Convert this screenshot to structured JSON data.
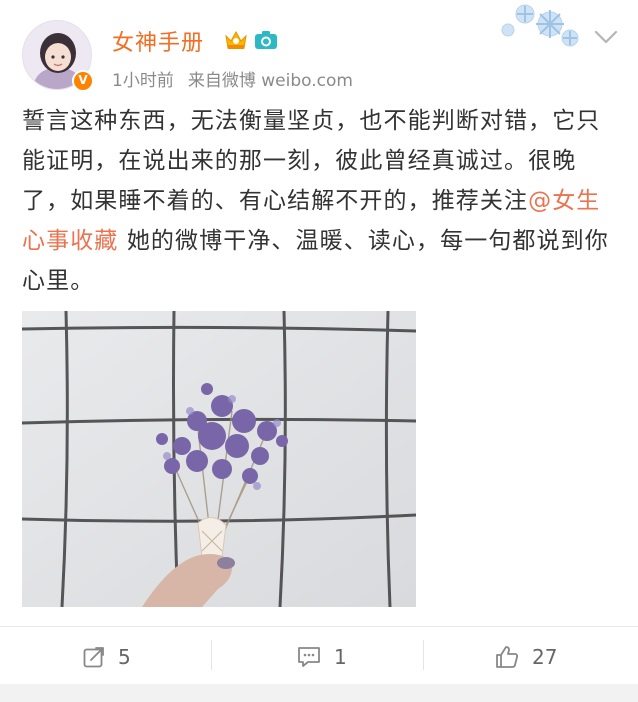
{
  "user": {
    "name": "女神手册",
    "verified_badge": "V",
    "time": "1小时前",
    "source": "来自微博 weibo.com"
  },
  "post": {
    "text_before": "誓言这种东西，无法衡量坚贞，也不能判断对错，它只能证明，在说出来的那一刻，彼此曾经真诚过。很晚了，如果睡不着的、有心结解不开的，推荐关注",
    "mention": "@女生心事收藏",
    "text_after": " 她的微博干净、温暖、读心，每一句都说到你心里。"
  },
  "actions": {
    "repost": {
      "icon": "share-icon",
      "count": "5"
    },
    "comment": {
      "icon": "comment-icon",
      "count": "1"
    },
    "like": {
      "icon": "thumbs-up-icon",
      "count": "27"
    }
  },
  "colors": {
    "username": "#f36d22",
    "mention": "#eb7350",
    "meta": "#8a8a8a",
    "badge": "#ff8200"
  }
}
